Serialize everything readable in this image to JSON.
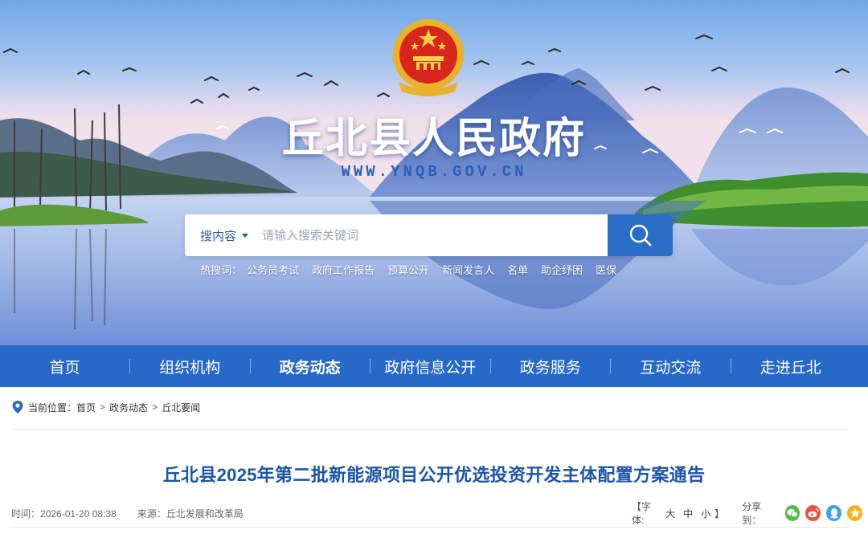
{
  "site": {
    "title": "丘北县人民政府",
    "url": "WWW.YNQB.GOV.CN"
  },
  "search": {
    "scope_label": "搜内容",
    "placeholder": "请输入搜索关键词",
    "button_icon": "search-icon"
  },
  "hot_words": {
    "label": "热搜词：",
    "items": [
      "公务员考试",
      "政府工作报告",
      "预算公开",
      "新闻发言人",
      "名单",
      "助企纾困",
      "医保"
    ]
  },
  "nav": {
    "items": [
      "首页",
      "组织机构",
      "政务动态",
      "政府信息公开",
      "政务服务",
      "互动交流",
      "走进丘北"
    ],
    "active": "政务动态"
  },
  "breadcrumb": {
    "prefix": "当前位置：",
    "items": [
      "首页",
      "政务动态",
      "丘北要闻"
    ],
    "separator": ">"
  },
  "article": {
    "title": "丘北县2025年第二批新能源项目公开优选投资开发主体配置方案通告",
    "time_label": "时间：",
    "time": "2026-01-20 08:38",
    "source_label": "来源：",
    "source": "丘北发展和改革局"
  },
  "tools": {
    "font_label": "【字体:",
    "font_sizes": [
      "大",
      "中",
      "小"
    ],
    "font_close": "】",
    "share_label": "分享到：",
    "share_icons": [
      "wechat-icon",
      "weibo-icon",
      "qq-icon",
      "qzone-icon"
    ]
  },
  "colors": {
    "nav_bg": "#2669c7",
    "title_blue": "#1a55a8",
    "search_button": "#2b6ec6",
    "wechat": "#58b947",
    "weibo": "#e8553e",
    "qq": "#3aa6e8",
    "qzone": "#f2b51f"
  }
}
